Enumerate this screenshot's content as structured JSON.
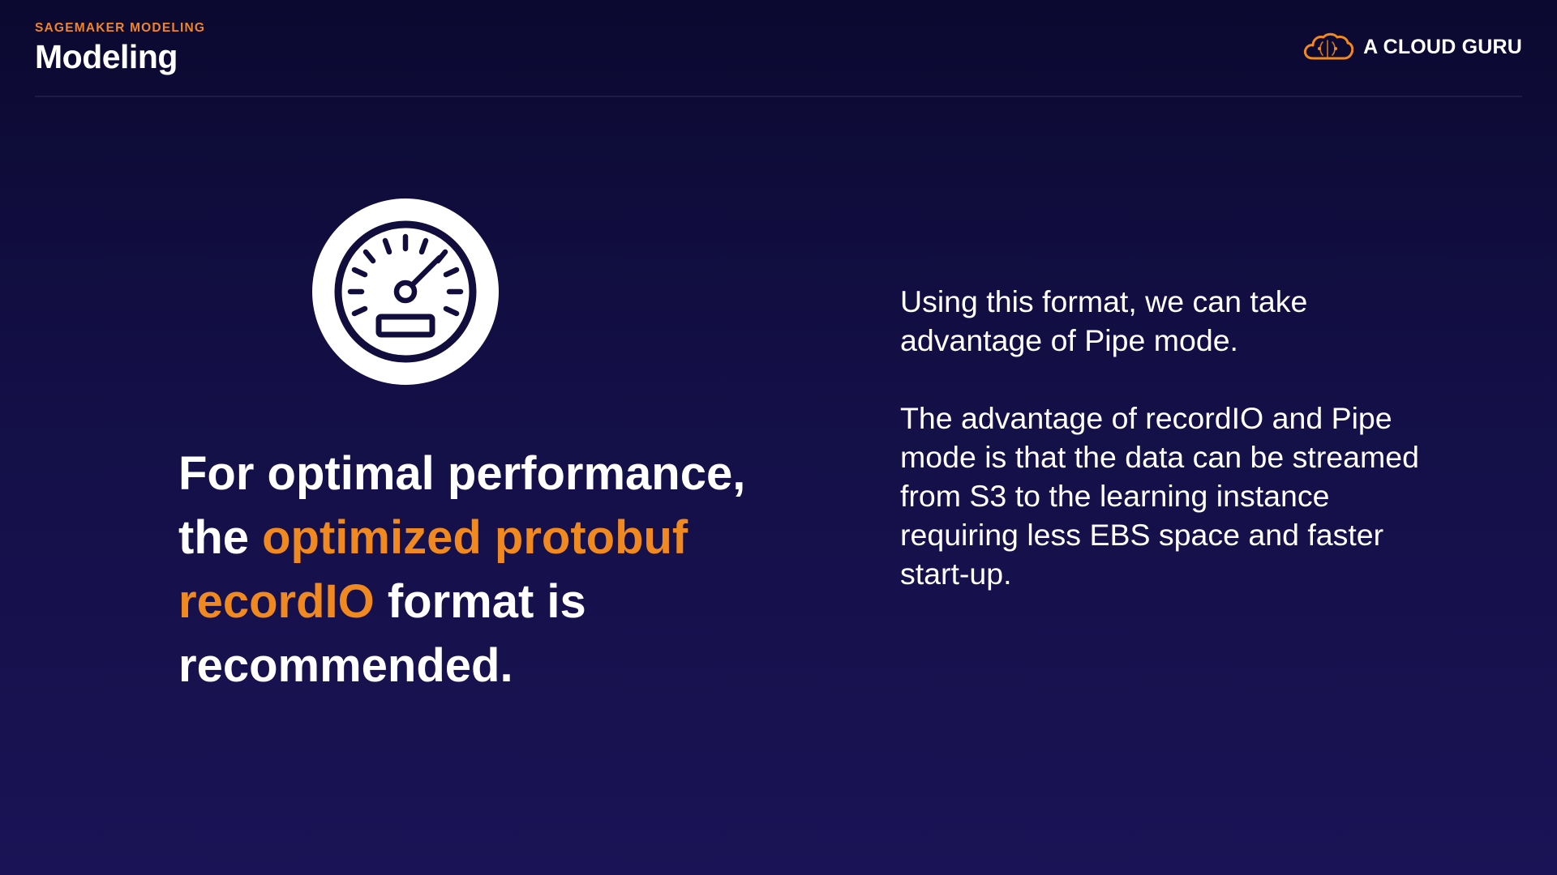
{
  "header": {
    "section_label": "SAGEMAKER MODELING",
    "title": "Modeling"
  },
  "brand": {
    "name": "A CLOUD GURU",
    "icon": "cloud-logo-icon"
  },
  "hero": {
    "icon": "speedometer-icon"
  },
  "headline": {
    "part1": "For optimal performance, the ",
    "highlight": "optimized protobuf recordIO",
    "part2": " format is recommended."
  },
  "body": {
    "paragraph1": "Using this format, we can take advantage of Pipe mode.",
    "paragraph2": "The advantage of recordIO and Pipe mode is that the data can be streamed from S3 to the learning instance requiring less EBS space and faster start-up."
  },
  "colors": {
    "accent": "#f0891f",
    "background_top": "#0b0930",
    "background_bottom": "#1a1355",
    "text": "#ffffff"
  }
}
